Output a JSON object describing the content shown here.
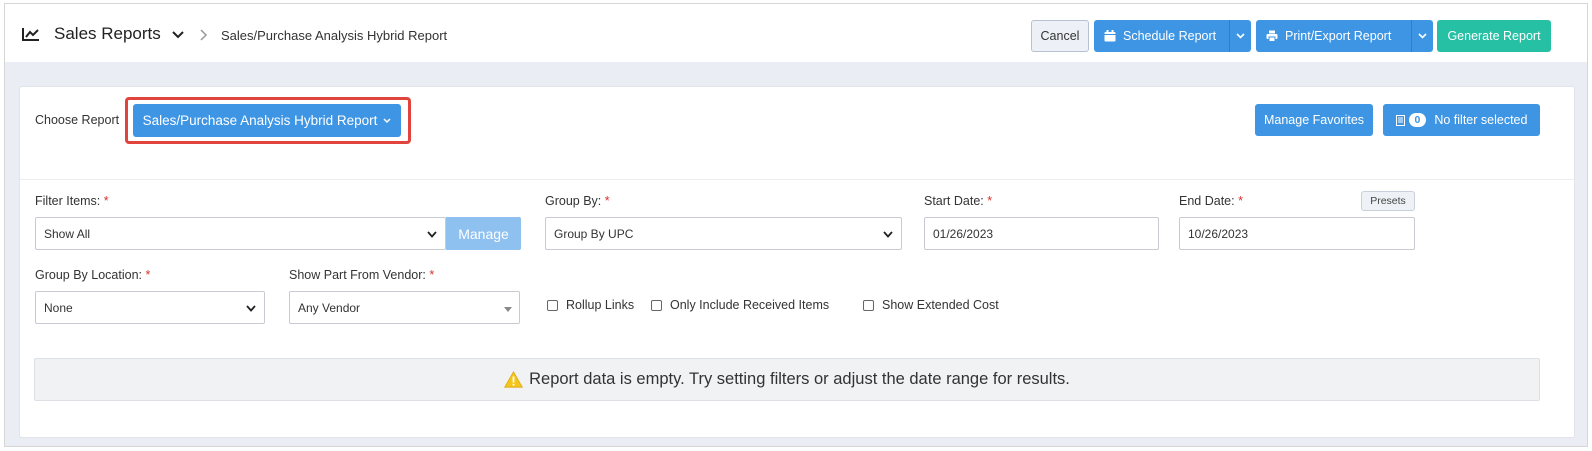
{
  "header": {
    "title": "Sales Reports",
    "breadcrumb": "Sales/Purchase Analysis Hybrid Report",
    "icons": [
      "chart-line-icon",
      "chevron-down-icon",
      "chevron-right-icon"
    ]
  },
  "toolbar": {
    "cancel_label": "Cancel",
    "schedule_label": "Schedule Report",
    "print_label": "Print/Export Report",
    "generate_label": "Generate Report"
  },
  "report_selector": {
    "label": "Choose Report",
    "selected": "Sales/Purchase Analysis Hybrid Report"
  },
  "favorites": {
    "label": "Manage Favorites"
  },
  "filter_status": {
    "count": "0",
    "label": "No filter selected"
  },
  "filters": {
    "filter_items": {
      "label": "Filter Items:",
      "value": "Show All",
      "manage_label": "Manage"
    },
    "group_by": {
      "label": "Group By:",
      "value": "Group By UPC"
    },
    "start_date": {
      "label": "Start Date:",
      "value": "01/26/2023"
    },
    "end_date": {
      "label": "End Date:",
      "value": "10/26/2023",
      "presets_label": "Presets"
    },
    "group_by_location": {
      "label": "Group By Location:",
      "value": "None"
    },
    "part_vendor": {
      "label": "Show Part From Vendor:",
      "value": "Any Vendor"
    },
    "required_marker": "*"
  },
  "checkboxes": [
    {
      "label": "Rollup Links",
      "checked": false
    },
    {
      "label": "Only Include Received Items",
      "checked": false
    },
    {
      "label": "Show Extended Cost",
      "checked": false
    }
  ],
  "empty_message": "Report data is empty. Try setting filters or adjust the date range for results.",
  "colors": {
    "primary": "#3d95e4",
    "success": "#26c0a4",
    "highlight": "#e0443c",
    "warning": "#f5c518",
    "required": "#d9302c"
  }
}
